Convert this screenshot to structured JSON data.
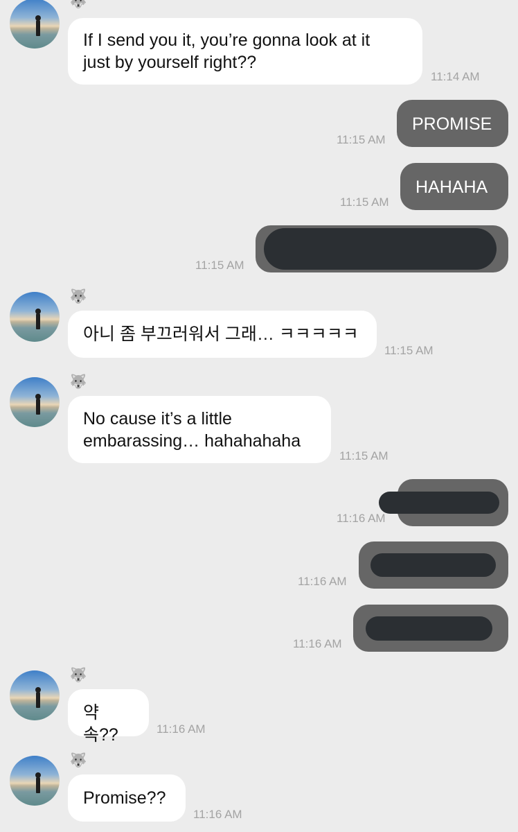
{
  "messages": [
    {
      "dir": "in",
      "text": "If I send you it, you’re gonna look at it\njust by yourself right??",
      "time": "11:14 AM"
    },
    {
      "dir": "out",
      "text": "PROMISE",
      "time": "11:15 AM"
    },
    {
      "dir": "out",
      "text": "HAHAHA",
      "time": "11:15 AM"
    },
    {
      "dir": "out",
      "text": "",
      "redacted": true,
      "time": "11:15 AM"
    },
    {
      "dir": "in",
      "text": "아니 좀 부끄러워서 그래… ㅋㅋㅋㅋㅋ",
      "time": "11:15 AM"
    },
    {
      "dir": "in",
      "text": "No cause it’s a little\nembarassing… hahahahaha",
      "time": "11:15 AM"
    },
    {
      "dir": "out",
      "text": "",
      "redacted": true,
      "time": "11:16 AM"
    },
    {
      "dir": "out",
      "text": "",
      "redacted": true,
      "time": "11:16 AM"
    },
    {
      "dir": "out",
      "text": "",
      "redacted": true,
      "time": "11:16 AM"
    },
    {
      "dir": "in",
      "text": "약속??",
      "time": "11:16 AM"
    },
    {
      "dir": "in",
      "text": "Promise??",
      "time": "11:16 AM"
    }
  ],
  "icons": {
    "sender_badge": "wolf-icon",
    "avatar": "profile-photo-beach"
  },
  "colors": {
    "background": "#ececec",
    "incoming_bubble": "#ffffff",
    "outgoing_bubble": "#666666",
    "redaction": "#2b2f33",
    "timestamp": "#a3a3a3"
  }
}
